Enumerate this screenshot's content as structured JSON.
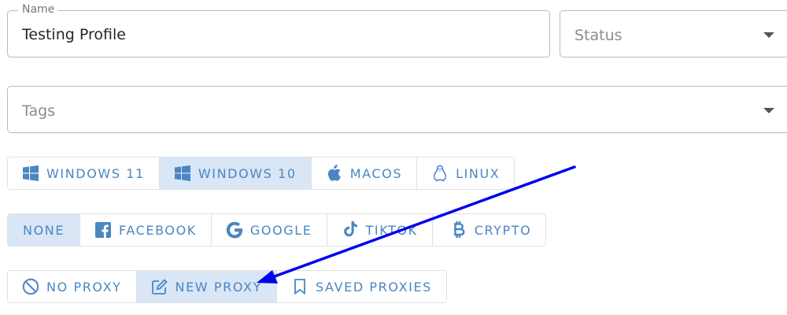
{
  "name_field": {
    "label": "Name",
    "value": "Testing Profile"
  },
  "status_field": {
    "placeholder": "Status"
  },
  "tags_field": {
    "placeholder": "Tags"
  },
  "os_group": [
    {
      "label": "WINDOWS 11",
      "icon": "windows-icon",
      "selected": false
    },
    {
      "label": "WINDOWS 10",
      "icon": "windows-icon",
      "selected": true
    },
    {
      "label": "MACOS",
      "icon": "apple-icon",
      "selected": false
    },
    {
      "label": "LINUX",
      "icon": "linux-icon",
      "selected": false
    }
  ],
  "platform_group": [
    {
      "label": "NONE",
      "selected": true
    },
    {
      "label": "FACEBOOK",
      "icon": "facebook-icon",
      "selected": false
    },
    {
      "label": "GOOGLE",
      "icon": "google-icon",
      "selected": false
    },
    {
      "label": "TIKTOK",
      "icon": "tiktok-icon",
      "selected": false
    },
    {
      "label": "CRYPTO",
      "icon": "bitcoin-icon",
      "selected": false
    }
  ],
  "proxy_group": [
    {
      "label": "NO PROXY",
      "icon": "no-proxy-icon",
      "selected": false
    },
    {
      "label": "NEW PROXY",
      "icon": "edit-icon",
      "selected": true
    },
    {
      "label": "SAVED PROXIES",
      "icon": "bookmark-icon",
      "selected": false
    }
  ],
  "colors": {
    "accent": "#4a86c2",
    "selected_bg": "#d9e6f5",
    "border": "#e1e1e1",
    "annotation_arrow": "#0000ee"
  }
}
